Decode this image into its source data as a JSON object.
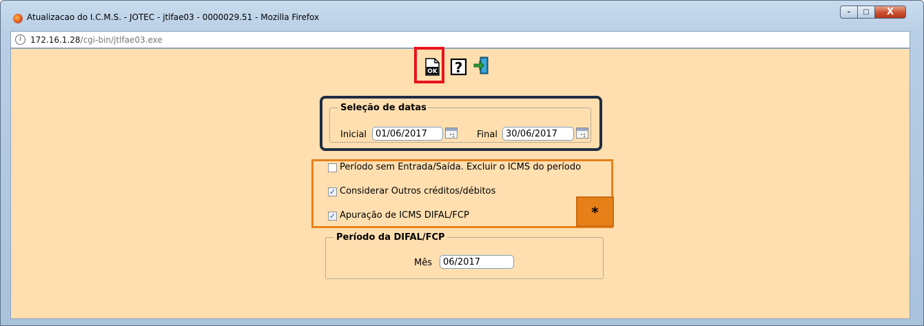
{
  "window": {
    "title": "Atualizacao do I.C.M.S. - JOTEC - jtlfae03 - 0000029.51 - Mozilla Firefox",
    "minimize_glyph": "–",
    "maximize_glyph": "□",
    "close_glyph": "X"
  },
  "urlbar": {
    "host": "172.16.1.28",
    "path": "/cgi-bin/jtlfae03.exe",
    "info_glyph": "i"
  },
  "toolbar": {
    "ok_icon": "ok-icon",
    "help_icon": "help-icon",
    "exit_icon": "exit-icon"
  },
  "selecao_datas": {
    "legend": "Seleção de datas",
    "inicial_label": "Inicial",
    "inicial_value": "01/06/2017",
    "final_label": "Final",
    "final_value": "30/06/2017"
  },
  "options": [
    {
      "label": "Período sem Entrada/Saída. Excluir o ICMS do período",
      "checked": false
    },
    {
      "label": "Considerar Outros créditos/débitos",
      "checked": true
    },
    {
      "label": "Apuração de ICMS DIFAL/FCP",
      "checked": true
    }
  ],
  "check_glyph": "✓",
  "star_badge": "*",
  "periodo_difal": {
    "legend": "Período da DIFAL/FCP",
    "mes_label": "Mês",
    "mes_value": "06/2017"
  },
  "colors": {
    "page_background": "#ffdfb0",
    "highlight_red": "#e8131b",
    "highlight_navy": "#1f2d44",
    "highlight_orange": "#e8801a"
  }
}
